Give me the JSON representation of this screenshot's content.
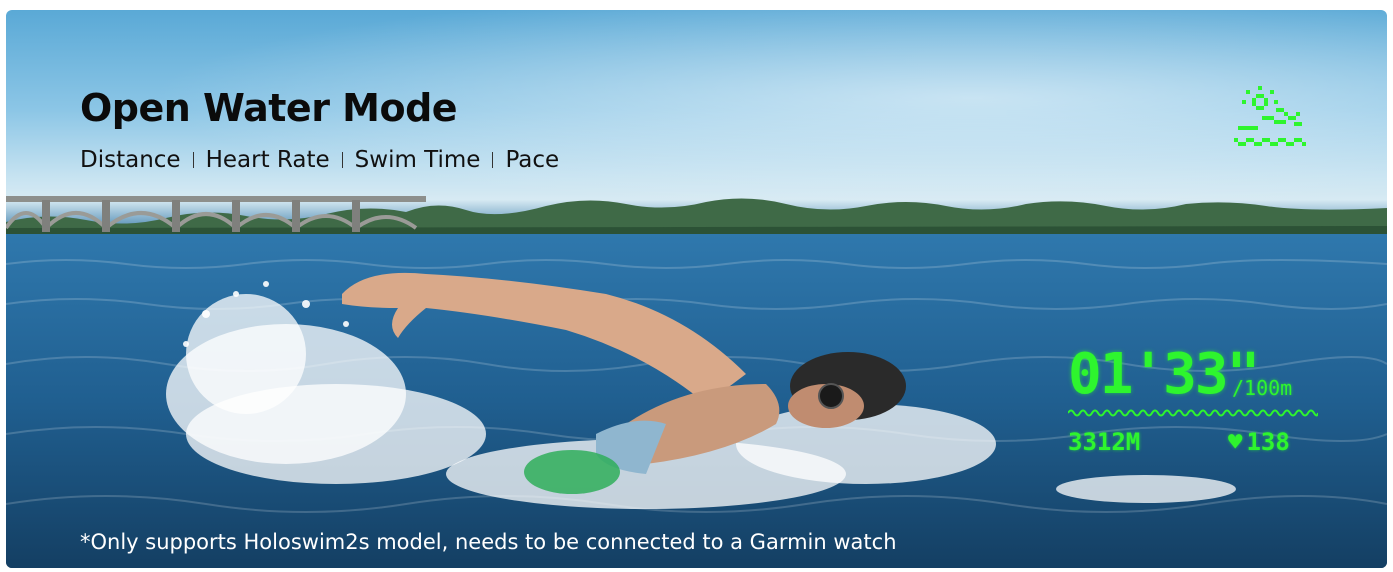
{
  "banner": {
    "title": "Open Water Mode",
    "metrics": [
      "Distance",
      "Heart Rate",
      "Swim Time",
      "Pace"
    ],
    "disclaimer": "*Only supports Holoswim2s model, needs to be connected to a Garmin watch"
  },
  "hud": {
    "pace_time": "01'33\"",
    "pace_unit": "/100m",
    "distance": "3312M",
    "heart_rate": "138",
    "heart_icon": "heart-icon",
    "accent_color": "#2ef52e"
  },
  "icons": {
    "open_water_icon": "open-water-swim-icon"
  }
}
